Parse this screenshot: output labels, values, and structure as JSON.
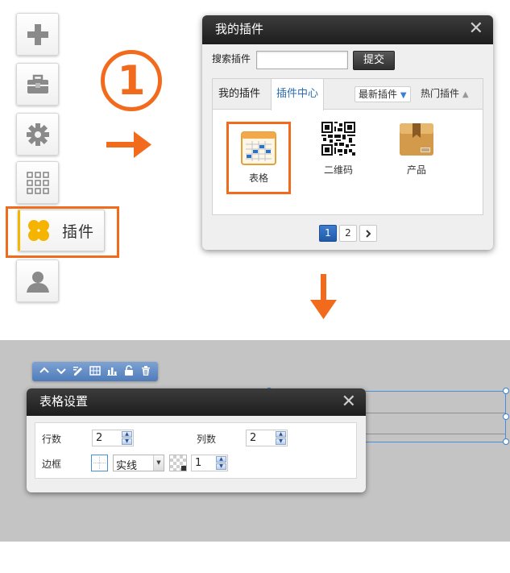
{
  "toolbar": {
    "items": [
      {
        "icon": "plus-icon"
      },
      {
        "icon": "toolbox-icon"
      },
      {
        "icon": "gear-icon"
      },
      {
        "icon": "grid-icon"
      },
      {
        "icon": "plugin-icon",
        "label": "插件"
      },
      {
        "icon": "user-icon"
      }
    ]
  },
  "step": {
    "number": "1"
  },
  "plugin_dialog": {
    "title": "我的插件",
    "close": "✕",
    "search_label": "搜索插件",
    "search_value": "",
    "submit_label": "提交",
    "tabs": {
      "mine": "我的插件",
      "center": "插件中心",
      "newest": "最新插件",
      "hot": "热门插件"
    },
    "items": [
      {
        "label": "表格",
        "icon": "table-icon",
        "selected": true
      },
      {
        "label": "二维码",
        "icon": "qrcode-icon"
      },
      {
        "label": "产品",
        "icon": "box-icon"
      }
    ],
    "pager": {
      "page1": "1",
      "page2": "2",
      "next": "›",
      "current": 1
    }
  },
  "table_settings": {
    "title": "表格设置",
    "close": "✕",
    "rows_label": "行数",
    "rows_value": "2",
    "cols_label": "列数",
    "cols_value": "2",
    "border_label": "边框",
    "border_style": "实线",
    "border_width": "1"
  },
  "colors": {
    "accent": "#f26b1d",
    "dark_header": "#2a2a2a",
    "link_blue": "#2a6eb6",
    "plugin_yellow": "#f4b400"
  }
}
